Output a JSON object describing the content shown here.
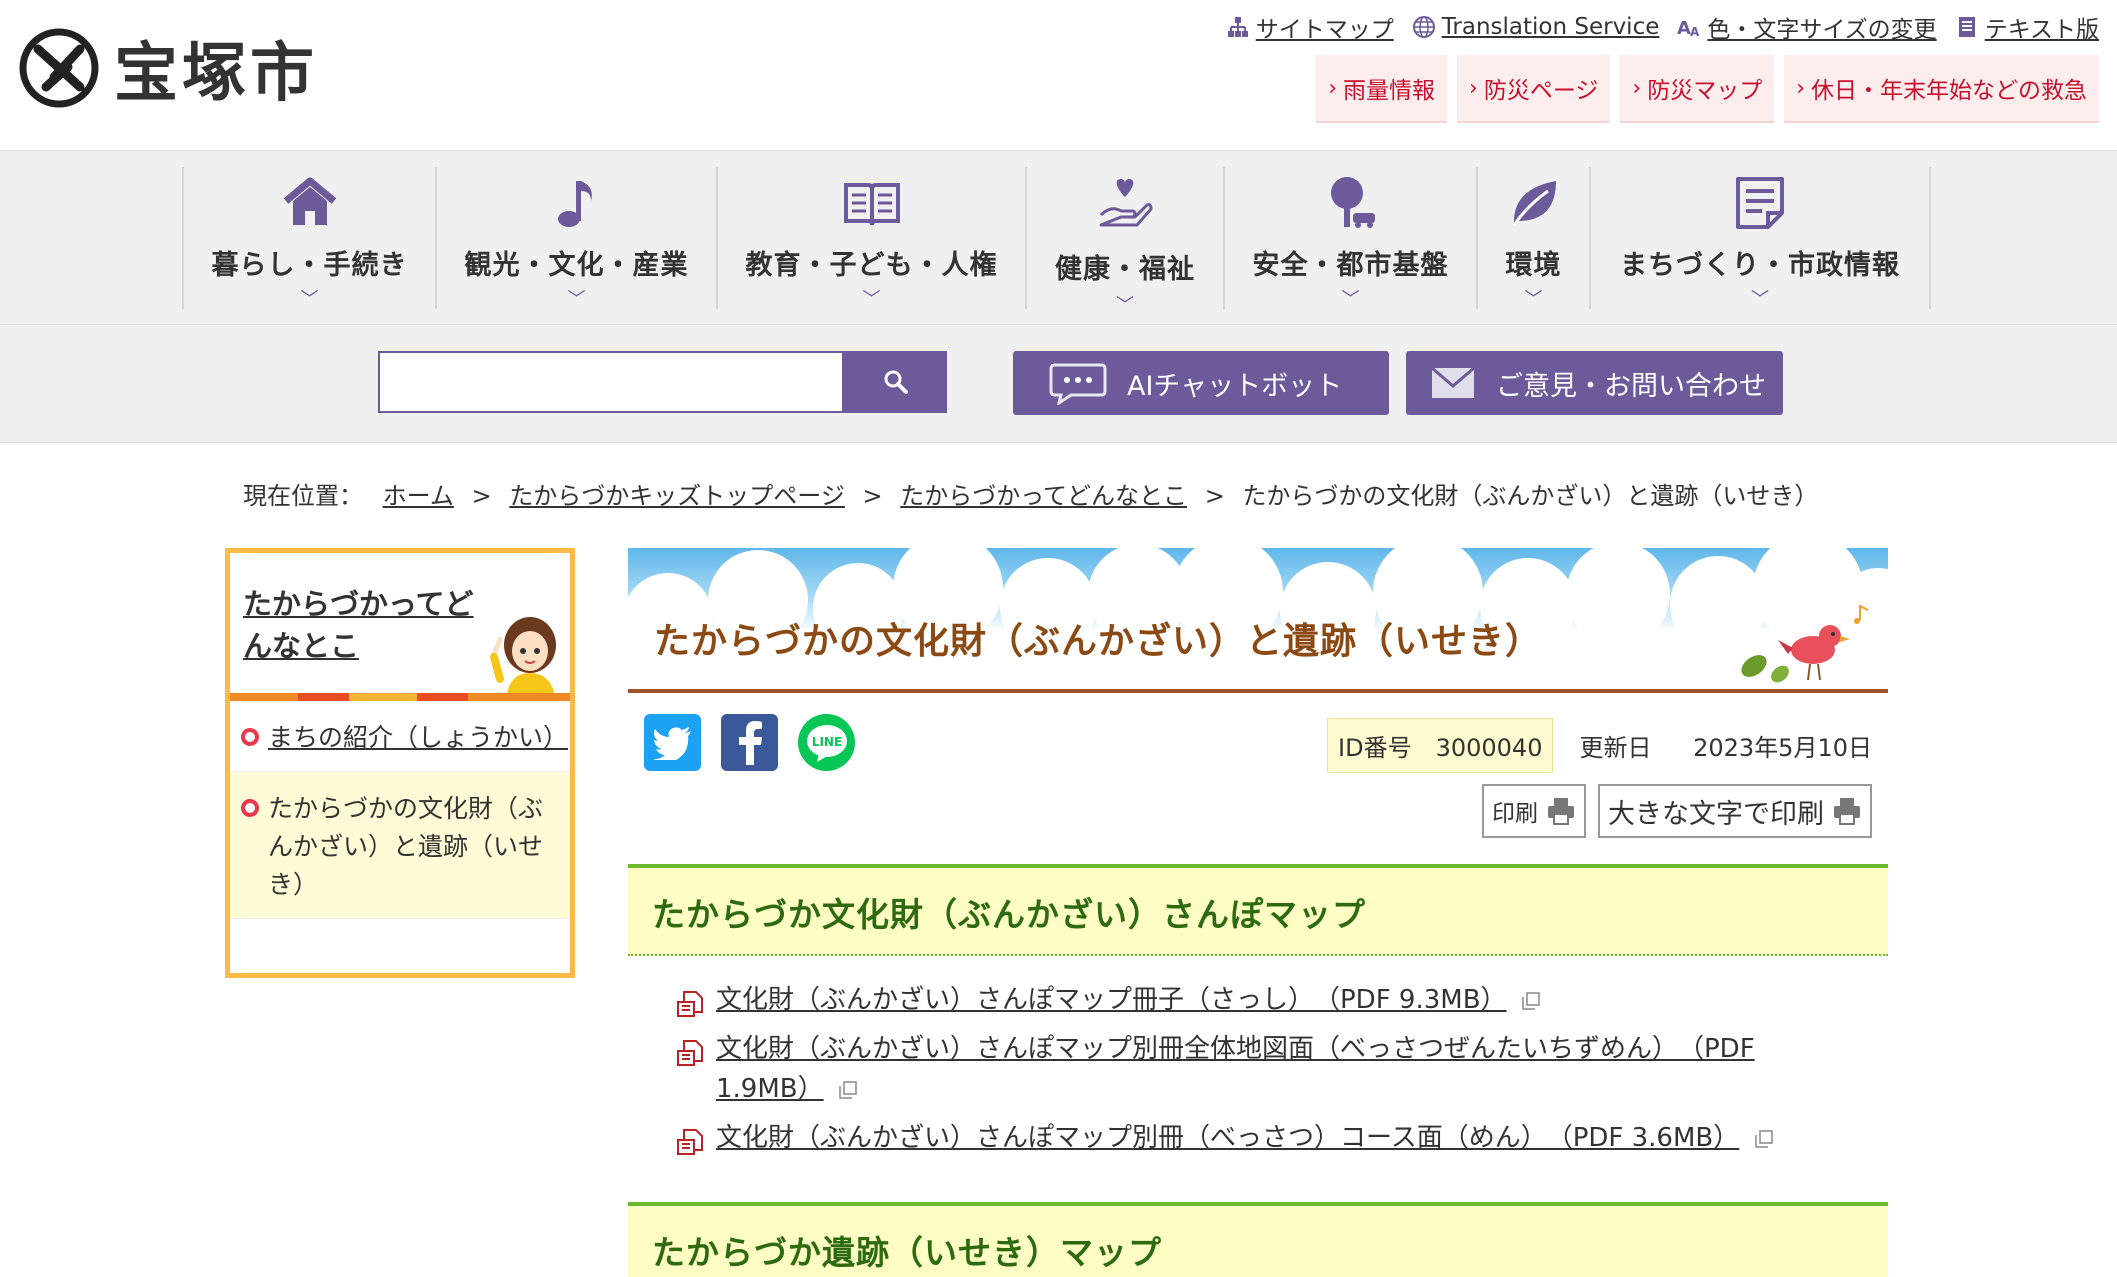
{
  "header": {
    "site_name": "宝塚市",
    "util_links": [
      {
        "label": "サイトマップ",
        "icon": "sitemap-icon"
      },
      {
        "label": "Translation Service",
        "icon": "globe-icon"
      },
      {
        "label": "色・文字サイズの変更",
        "icon": "text-size-icon"
      },
      {
        "label": "テキスト版",
        "icon": "document-icon"
      }
    ],
    "alert_links": [
      "雨量情報",
      "防災ページ",
      "防災マップ",
      "休日・年末年始などの救急"
    ]
  },
  "gnav": [
    {
      "label": "暮らし・手続き",
      "icon": "house-icon"
    },
    {
      "label": "観光・文化・産業",
      "icon": "music-note-icon"
    },
    {
      "label": "教育・子ども・人権",
      "icon": "open-book-icon"
    },
    {
      "label": "健康・福祉",
      "icon": "heart-hand-icon"
    },
    {
      "label": "安全・都市基盤",
      "icon": "tree-car-icon"
    },
    {
      "label": "環境",
      "icon": "leaf-icon"
    },
    {
      "label": "まちづくり・市政情報",
      "icon": "notepad-icon"
    }
  ],
  "search": {
    "placeholder": "",
    "button_icon": "search-icon"
  },
  "chatbot_label": "AIチャットボット",
  "contact_label": "ご意見・お問い合わせ",
  "breadcrumb": {
    "prefix": "現在位置：",
    "items": [
      "ホーム",
      "たからづかキッズトップページ",
      "たからづかってどんなとこ"
    ],
    "current": "たからづかの文化財（ぶんかざい）と遺跡（いせき）",
    "separator": ">"
  },
  "side": {
    "title": "たからづかってどんなとこ",
    "items": [
      {
        "label": "まちの紹介（しょうかい）",
        "current": false
      },
      {
        "label": "たからづかの文化財（ぶんかざい）と遺跡（いせき）",
        "current": true
      }
    ]
  },
  "page": {
    "title": "たからづかの文化財（ぶんかざい）と遺跡（いせき）",
    "id_label": "ID番号　3000040",
    "updated_label": "更新日",
    "updated_date": "2023年5月10日",
    "print_label": "印刷",
    "print_large_label": "大きな文字で印刷"
  },
  "share": [
    {
      "name": "twitter",
      "color": "#1da1f2"
    },
    {
      "name": "facebook",
      "color": "#3b5998"
    },
    {
      "name": "line",
      "color": "#06c755"
    }
  ],
  "sections": [
    {
      "heading": "たからづか文化財（ぶんかざい）さんぽマップ",
      "docs": [
        "文化財（ぶんかざい）さんぽマップ冊子（さっし）　（PDF 9.3MB）",
        "文化財（ぶんかざい）さんぽマップ別冊全体地図面（べっさつぜんたいちずめん）　（PDF 1.9MB）",
        "文化財（ぶんかざい）さんぽマップ別冊（べっさつ）コース面（めん）　（PDF 3.6MB）"
      ]
    },
    {
      "heading": "たからづか遺跡（いせき）マップ",
      "docs": []
    }
  ],
  "colors": {
    "brand_purple": "#6c5a9b",
    "alert_red": "#c8102e",
    "section_green": "#6fba2c",
    "title_brown": "#8b4a14",
    "side_orange": "#ffba45"
  }
}
